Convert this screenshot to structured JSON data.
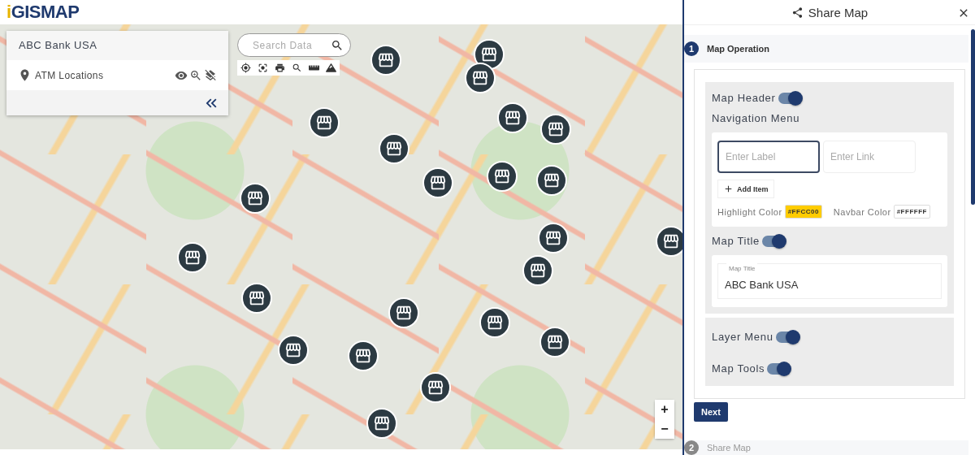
{
  "logo": {
    "letter": "i",
    "text": "GISMAP"
  },
  "layer_panel": {
    "title": "ABC Bank USA",
    "layers": [
      {
        "name": "ATM Locations",
        "visible": true
      }
    ]
  },
  "search": {
    "placeholder": "Search Data"
  },
  "zoom_controls": [
    "+",
    "−"
  ],
  "share_panel": {
    "title": "Share Map",
    "steps": [
      {
        "number": "1",
        "label": "Map Operation",
        "selected": true
      },
      {
        "number": "2",
        "label": "Share Map",
        "selected": false
      }
    ],
    "map_header": {
      "label": "Map Header",
      "on": true
    },
    "navigation_menu": {
      "label": "Navigation Menu",
      "label_field": {
        "placeholder": "Enter Label",
        "focused": true
      },
      "link_field": {
        "placeholder": "Enter Link",
        "focused": false
      },
      "add_button": "Add Item",
      "colors": [
        {
          "label": "Highlight Color",
          "value": "#FFCC00",
          "color": "#ffcc00"
        },
        {
          "label": "Navbar Color",
          "value": "#FFFFFF",
          "color": "#ffffff"
        }
      ]
    },
    "map_title": {
      "label": "Map Title",
      "on": true,
      "field_label": "Map Title",
      "value": "ABC Bank USA"
    },
    "toggles": [
      {
        "label": "Layer Menu",
        "on": true
      },
      {
        "label": "Map Tools",
        "on": true
      }
    ],
    "next_button": "Next"
  }
}
